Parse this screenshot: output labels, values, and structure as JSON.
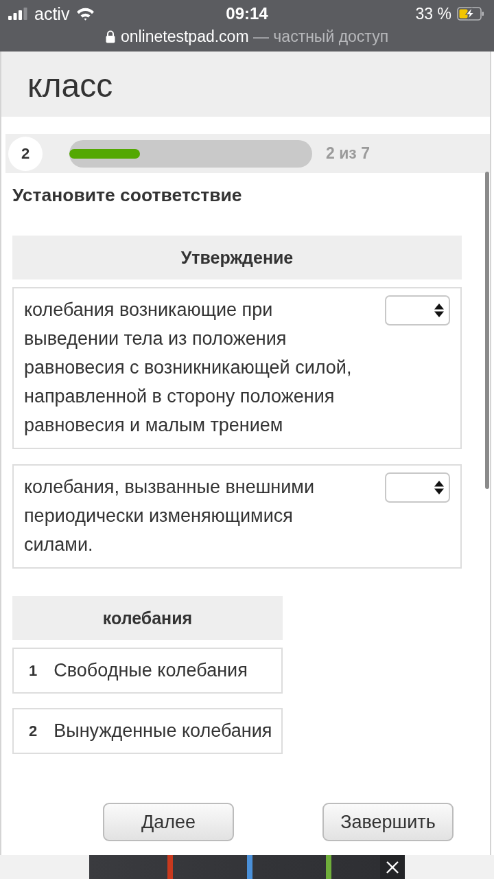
{
  "status_bar": {
    "carrier": "activ",
    "time": "09:14",
    "battery": "33 %"
  },
  "address_bar": {
    "domain": "onlinetestpad.com",
    "note": "— частный доступ"
  },
  "header": {
    "title": "класс"
  },
  "progress": {
    "question_number": "2",
    "level": 0.29,
    "counter": "2 из 7"
  },
  "question": {
    "prompt": "Установите соответствие",
    "statements": {
      "heading": "Утверждение",
      "items": [
        {
          "text": "колебания возникающие при выведении тела из положения равновесия с возникникающей силой, направленной в сторону положения равновесия и малым трением"
        },
        {
          "text": "колебания, вызванные внешними периодически изменяющимися силами."
        }
      ]
    },
    "options": {
      "heading": "колебания",
      "items": [
        {
          "number": "1",
          "text": "Свободные колебания"
        },
        {
          "number": "2",
          "text": "Вынужденные колебания"
        }
      ]
    }
  },
  "buttons": [
    {
      "label": "Далее"
    },
    {
      "label": "Завершить"
    }
  ]
}
